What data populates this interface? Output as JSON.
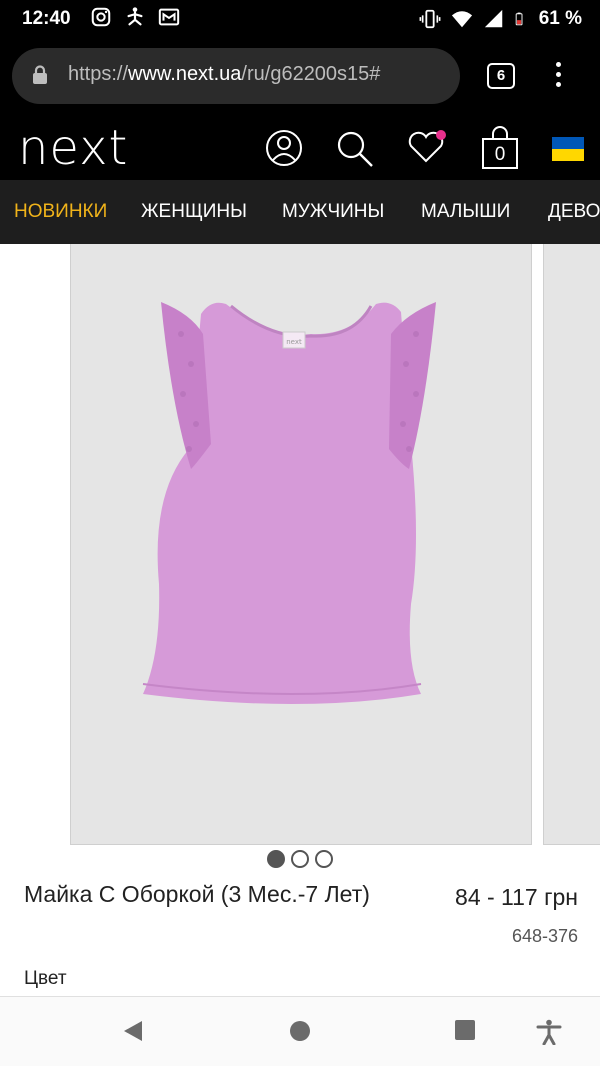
{
  "status_bar": {
    "time": "12:40",
    "battery": "61 %",
    "icons": [
      "instagram-icon",
      "yoga-icon",
      "gmail-icon",
      "vibrate-icon",
      "wifi-icon",
      "signal-icon",
      "battery-icon"
    ]
  },
  "browser": {
    "url_scheme": "https://",
    "url_domain": "www.next.ua",
    "url_path": "/ru/g62200s15#",
    "tab_count": "6"
  },
  "header": {
    "logo": "next",
    "cart_count": "0",
    "colors": {
      "wishlist_dot": "#e8308c",
      "flag_blue": "#0057b7",
      "flag_yellow": "#ffd700"
    }
  },
  "nav": {
    "items": [
      {
        "label": "НОВИНКИ"
      },
      {
        "label": "ЖЕНЩИНЫ"
      },
      {
        "label": "МУЖЧИНЫ"
      },
      {
        "label": "МАЛЫШИ"
      },
      {
        "label": "ДЕВО"
      }
    ],
    "active_color": "#f0b31a"
  },
  "product": {
    "title": "Майка С Оборкой (3 Мес.-7 Лет)",
    "price": "84 - 117 грн",
    "sku": "648-376",
    "color_label": "Цвет",
    "shirt_color": "#d69ad8",
    "image_tag": "next",
    "gallery_dots": 3,
    "active_dot": 0
  }
}
